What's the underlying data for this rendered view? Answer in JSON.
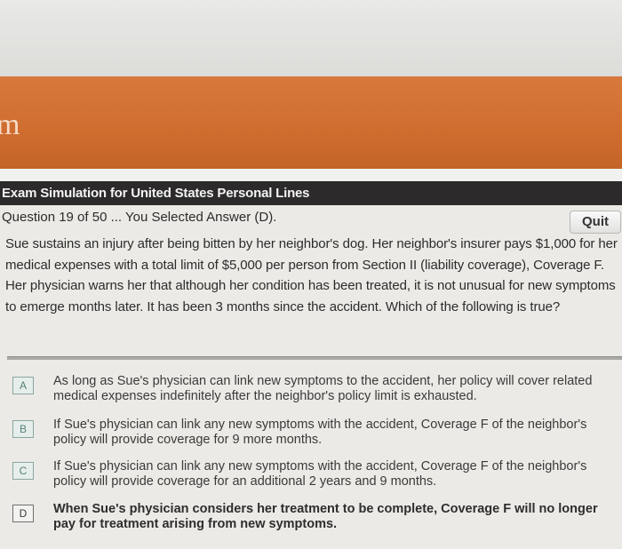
{
  "header": {
    "logo_text": "m",
    "exam_title": "Exam Simulation for United States Personal Lines"
  },
  "question": {
    "progress_text": "Question 19 of 50 ... You Selected Answer (D).",
    "quit_label": "Quit",
    "body": "Sue sustains an injury after being bitten by her neighbor's dog. Her neighbor's insurer pays $1,000 for her medical expenses with a total limit of $5,000 per person from Section II (liability coverage), Coverage F. Her physician warns her that although her condition has been treated, it is not unusual for new symptoms to emerge months later. It has been 3 months since the accident. Which of the following is true?"
  },
  "answers": [
    {
      "letter": "A",
      "text": "As long as Sue's physician can link new symptoms to the accident, her policy will cover related medical expenses indefinitely after the neighbor's policy limit is exhausted."
    },
    {
      "letter": "B",
      "text": "If Sue's physician can link any new symptoms with the accident, Coverage F of the neighbor's policy will provide coverage for 9 more months."
    },
    {
      "letter": "C",
      "text": "If Sue's physician can link any new symptoms with the accident, Coverage F of the neighbor's policy will provide coverage for an additional 2 years and 9 months."
    },
    {
      "letter": "D",
      "text": "When Sue's physician considers her treatment to be complete, Coverage F will no longer pay for treatment arising from new symptoms."
    }
  ],
  "selected_answer": "D"
}
